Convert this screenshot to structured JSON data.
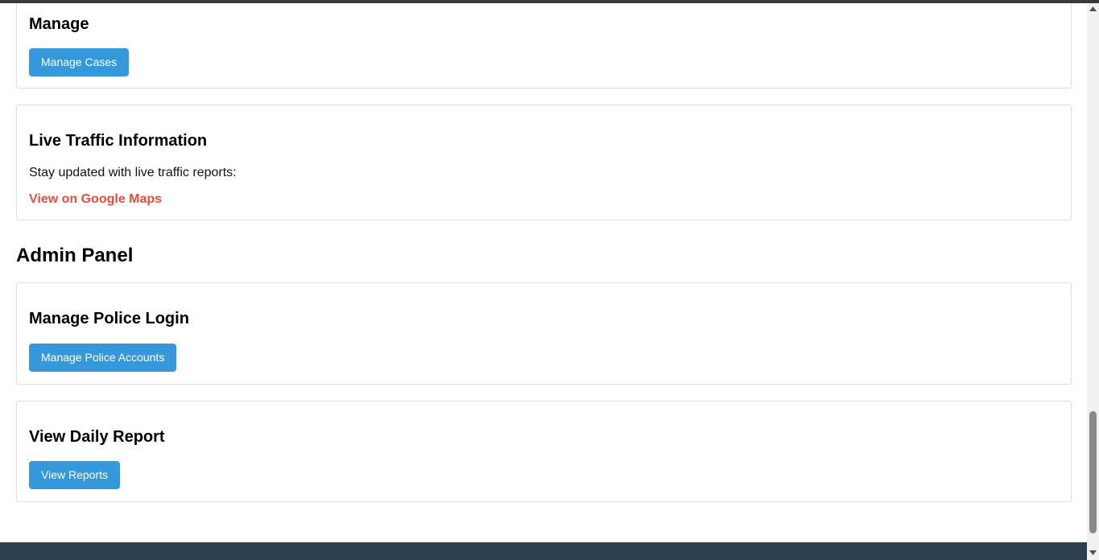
{
  "manage_card": {
    "title": "Manage",
    "button_label": "Manage Cases"
  },
  "traffic_card": {
    "title": "Live Traffic Information",
    "text": "Stay updated with live traffic reports:",
    "link_label": "View on Google Maps"
  },
  "admin_panel": {
    "title": "Admin Panel",
    "police_login_card": {
      "title": "Manage Police Login",
      "button_label": "Manage Police Accounts"
    },
    "daily_report_card": {
      "title": "View Daily Report",
      "button_label": "View Reports"
    }
  },
  "colors": {
    "button_bg": "#3498db",
    "link": "#e74c3c",
    "footer": "#2c3e50"
  },
  "icons": {
    "scroll_up": "scroll-up-arrow-icon",
    "scroll_down": "scroll-down-arrow-icon"
  }
}
